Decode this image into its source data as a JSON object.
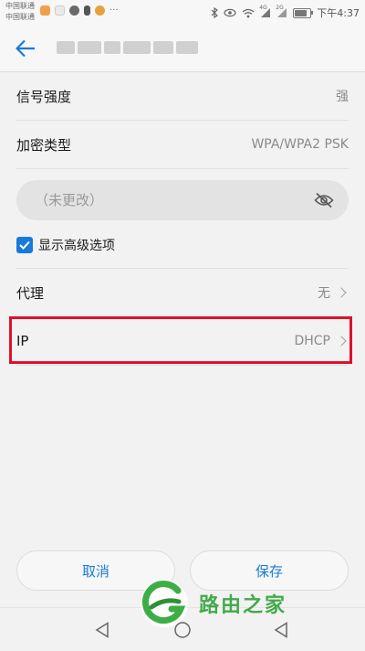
{
  "status_bar": {
    "carrier_1": "中国联通",
    "carrier_2": "中国联通",
    "more": "···",
    "time": "下午4:37",
    "signal_label_1": "4G",
    "signal_label_2": "2G"
  },
  "header": {
    "back_icon": "back-arrow-icon",
    "accent_color": "#1a7ad9"
  },
  "rows": {
    "signal_strength": {
      "label": "信号强度",
      "value": "强"
    },
    "encryption": {
      "label": "加密类型",
      "value": "WPA/WPA2 PSK"
    },
    "password": {
      "placeholder": "（未更改）",
      "value": "",
      "eye_icon": "eye-off-icon"
    },
    "advanced": {
      "label": "显示高级选项",
      "checked": true
    },
    "proxy": {
      "label": "代理",
      "value": "无"
    },
    "ip": {
      "label": "IP",
      "value": "DHCP"
    }
  },
  "buttons": {
    "cancel": "取消",
    "save": "保存"
  },
  "watermark": {
    "text": "路由之家",
    "color": "#34a43c"
  },
  "highlight_color": "#e0102a"
}
